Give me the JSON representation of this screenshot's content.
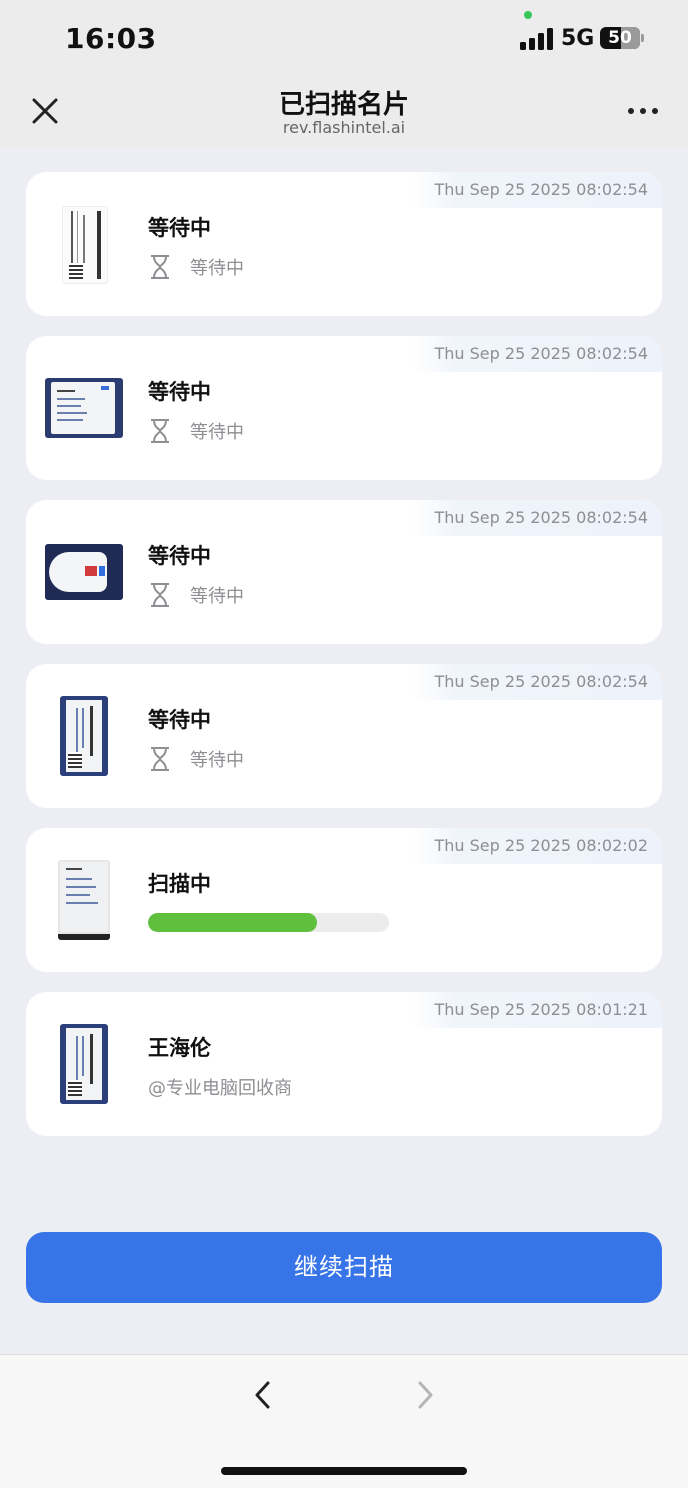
{
  "status_bar": {
    "time": "16:03",
    "network": "5G",
    "battery": "50"
  },
  "header": {
    "title": "已扫描名片",
    "subtitle": "rev.flashintel.ai",
    "close_icon": "close-icon",
    "more_icon": "more-horizontal-icon"
  },
  "cards": [
    {
      "timestamp": "Thu Sep 25 2025 08:02:54",
      "title": "等待中",
      "status": "等待中",
      "icon": "hourglass-icon"
    },
    {
      "timestamp": "Thu Sep 25 2025 08:02:54",
      "title": "等待中",
      "status": "等待中",
      "icon": "hourglass-icon"
    },
    {
      "timestamp": "Thu Sep 25 2025 08:02:54",
      "title": "等待中",
      "status": "等待中",
      "icon": "hourglass-icon"
    },
    {
      "timestamp": "Thu Sep 25 2025 08:02:54",
      "title": "等待中",
      "status": "等待中",
      "icon": "hourglass-icon"
    },
    {
      "timestamp": "Thu Sep 25 2025 08:02:02",
      "title": "扫描中",
      "progress": 0.7
    },
    {
      "timestamp": "Thu Sep 25 2025 08:01:21",
      "title": "王海伦",
      "company": "@专业电脑回收商"
    }
  ],
  "continue_button": {
    "label": "继续扫描"
  },
  "toolbar": {
    "back_icon": "chevron-left-icon",
    "forward_icon": "chevron-right-icon"
  },
  "colors": {
    "accent": "#3774e8",
    "progress": "#5ec03c",
    "background": "#edeef3"
  }
}
